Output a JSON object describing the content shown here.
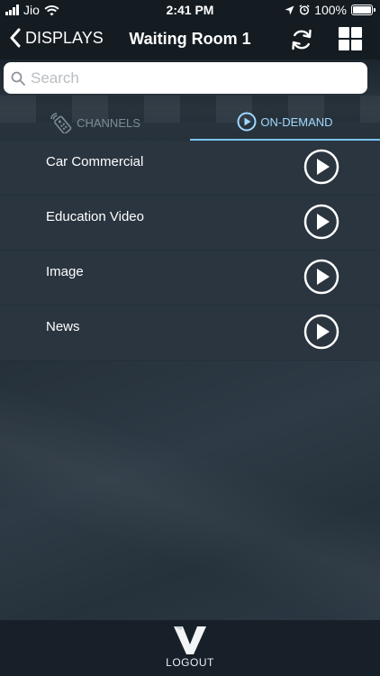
{
  "status": {
    "carrier": "Jio",
    "time": "2:41 PM",
    "battery": "100%"
  },
  "nav": {
    "back_label": "DISPLAYS",
    "title": "Waiting Room 1"
  },
  "search": {
    "placeholder": "Search",
    "value": ""
  },
  "tabs": {
    "channels": "CHANNELS",
    "on_demand": "ON-DEMAND",
    "active": "on_demand"
  },
  "items": [
    {
      "label": "Car Commercial"
    },
    {
      "label": "Education Video"
    },
    {
      "label": "Image"
    },
    {
      "label": "News"
    }
  ],
  "footer": {
    "logout_label": "LOGOUT"
  },
  "colors": {
    "active_tab": "#9fd8ff",
    "inactive_tab": "#7f8c96",
    "row_bg": "#2a3540",
    "bar_bg": "#141c22"
  },
  "icons": [
    "signal-icon",
    "wifi-icon",
    "location-icon",
    "alarm-icon",
    "battery-icon",
    "back-chevron-icon",
    "refresh-icon",
    "grid-icon",
    "search-icon",
    "remote-icon",
    "play-circle-icon",
    "logo-icon"
  ]
}
